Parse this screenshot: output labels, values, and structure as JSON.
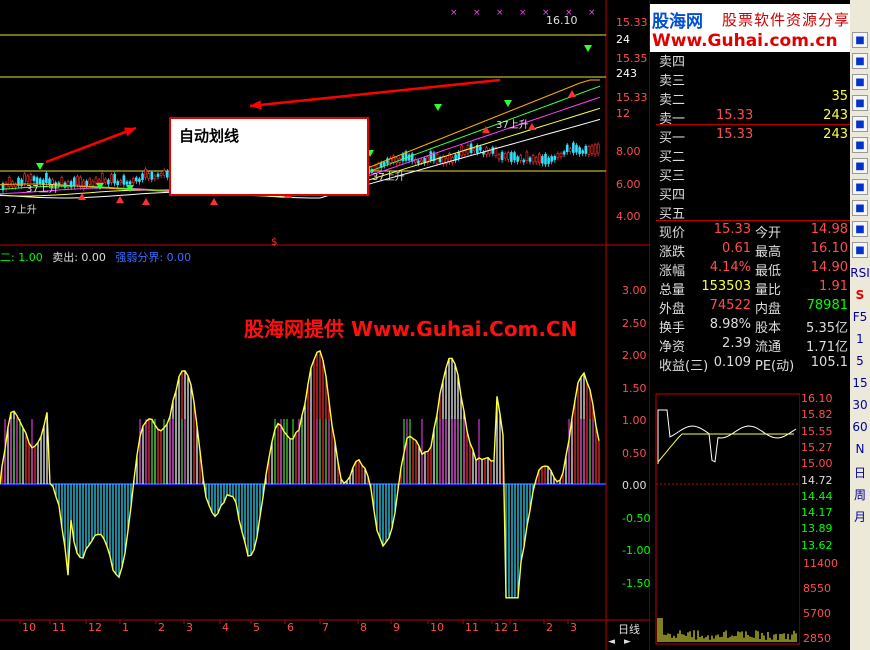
{
  "main_chart": {
    "price_ticks": [
      "15.33",
      "24",
      "15.35",
      "243",
      "15.33",
      "12",
      "8.00",
      "6.00",
      "4.00"
    ],
    "high_label": "16.10",
    "annotation_label": "37上升",
    "annotation_labels": [
      "37上升",
      "37上升",
      "37上升",
      "37上升"
    ],
    "marker_s": "$"
  },
  "indicator": {
    "buy_label": "二: 1.00",
    "sell_label": "卖出: 0.00",
    "boundary_label": "强弱分界: 0.00",
    "y_ticks": [
      "3.00",
      "2.50",
      "2.00",
      "1.50",
      "1.00",
      "0.50",
      "0.00",
      "-0.50",
      "-1.00",
      "-1.50"
    ]
  },
  "x_axis": {
    "month_labels": [
      "10",
      "11",
      "12",
      "1",
      "2",
      "3",
      "4",
      "5",
      "6",
      "7",
      "8",
      "9",
      "10",
      "11",
      "12",
      "1",
      "2",
      "3"
    ]
  },
  "callout": {
    "text": "自动划线"
  },
  "watermark": {
    "text": "股海网提供 Www.Guhai.Com.CN"
  },
  "logo": {
    "brand": "股海网",
    "tagline": "股票软件资源分享",
    "url": "Www.Guhai.com.cn"
  },
  "order_book": {
    "sell": [
      {
        "label": "卖四",
        "price": "",
        "vol": ""
      },
      {
        "label": "卖三",
        "price": "",
        "vol": ""
      },
      {
        "label": "卖二",
        "price": "",
        "vol": "35"
      },
      {
        "label": "卖一",
        "price": "15.33",
        "vol": "243"
      }
    ],
    "buy": [
      {
        "label": "买一",
        "price": "15.33",
        "vol": "243"
      },
      {
        "label": "买二",
        "price": "",
        "vol": ""
      },
      {
        "label": "买三",
        "price": "",
        "vol": ""
      },
      {
        "label": "买四",
        "price": "",
        "vol": ""
      },
      {
        "label": "买五",
        "price": "",
        "vol": ""
      }
    ]
  },
  "quote_stats": [
    {
      "k1": "现价",
      "v1": "15.33",
      "k2": "今开",
      "v2": "14.98",
      "c1": "#ff4d4d",
      "c2": "#ff4d4d"
    },
    {
      "k1": "涨跌",
      "v1": "0.61",
      "k2": "最高",
      "v2": "16.10",
      "c1": "#ff4d4d",
      "c2": "#ff4d4d"
    },
    {
      "k1": "涨幅",
      "v1": "4.14%",
      "k2": "最低",
      "v2": "14.90",
      "c1": "#ff4d4d",
      "c2": "#ff4d4d"
    },
    {
      "k1": "总量",
      "v1": "153503",
      "k2": "量比",
      "v2": "1.91",
      "c1": "#ffff40",
      "c2": "#ff4d4d"
    },
    {
      "k1": "外盘",
      "v1": "74522",
      "k2": "内盘",
      "v2": "78981",
      "c1": "#ff4d4d",
      "c2": "#00ff00"
    },
    {
      "k1": "换手",
      "v1": "8.98%",
      "k2": "股本",
      "v2": "5.35亿",
      "c1": "#ddd",
      "c2": "#ddd"
    },
    {
      "k1": "净资",
      "v1": "2.39",
      "k2": "流通",
      "v2": "1.71亿",
      "c1": "#ddd",
      "c2": "#ddd"
    },
    {
      "k1": "收益(三)",
      "v1": "0.109",
      "k2": "PE(动)",
      "v2": "105.1",
      "c1": "#ddd",
      "c2": "#ddd"
    }
  ],
  "mini_chart": {
    "price_labels": [
      {
        "t": "16.10",
        "c": "#ff4d4d"
      },
      {
        "t": "15.82",
        "c": "#ff4d4d"
      },
      {
        "t": "15.55",
        "c": "#ff4d4d"
      },
      {
        "t": "15.27",
        "c": "#ff4d4d"
      },
      {
        "t": "15.00",
        "c": "#ff4d4d"
      },
      {
        "t": "14.72",
        "c": "#ddd"
      },
      {
        "t": "14.44",
        "c": "#00ff00"
      },
      {
        "t": "14.17",
        "c": "#00ff00"
      },
      {
        "t": "13.89",
        "c": "#00ff00"
      },
      {
        "t": "13.62",
        "c": "#00ff00"
      }
    ],
    "vol_labels": [
      "11400",
      "8550",
      "5700",
      "2850"
    ]
  },
  "period_tab": "日线",
  "toolbar": {
    "icons": [
      "bar-chart-icon",
      "grid-icon",
      "F10-icon",
      "book-icon",
      "text-icon",
      "F5-style-icon",
      "Fiz-icon",
      "calendar-icon",
      "search-icon",
      "crosshair-icon",
      "wave-icon"
    ],
    "labels": [
      "RSI",
      "S",
      "F5",
      "1",
      "5",
      "15",
      "30",
      "60",
      "N",
      "日",
      "周",
      "月"
    ]
  }
}
